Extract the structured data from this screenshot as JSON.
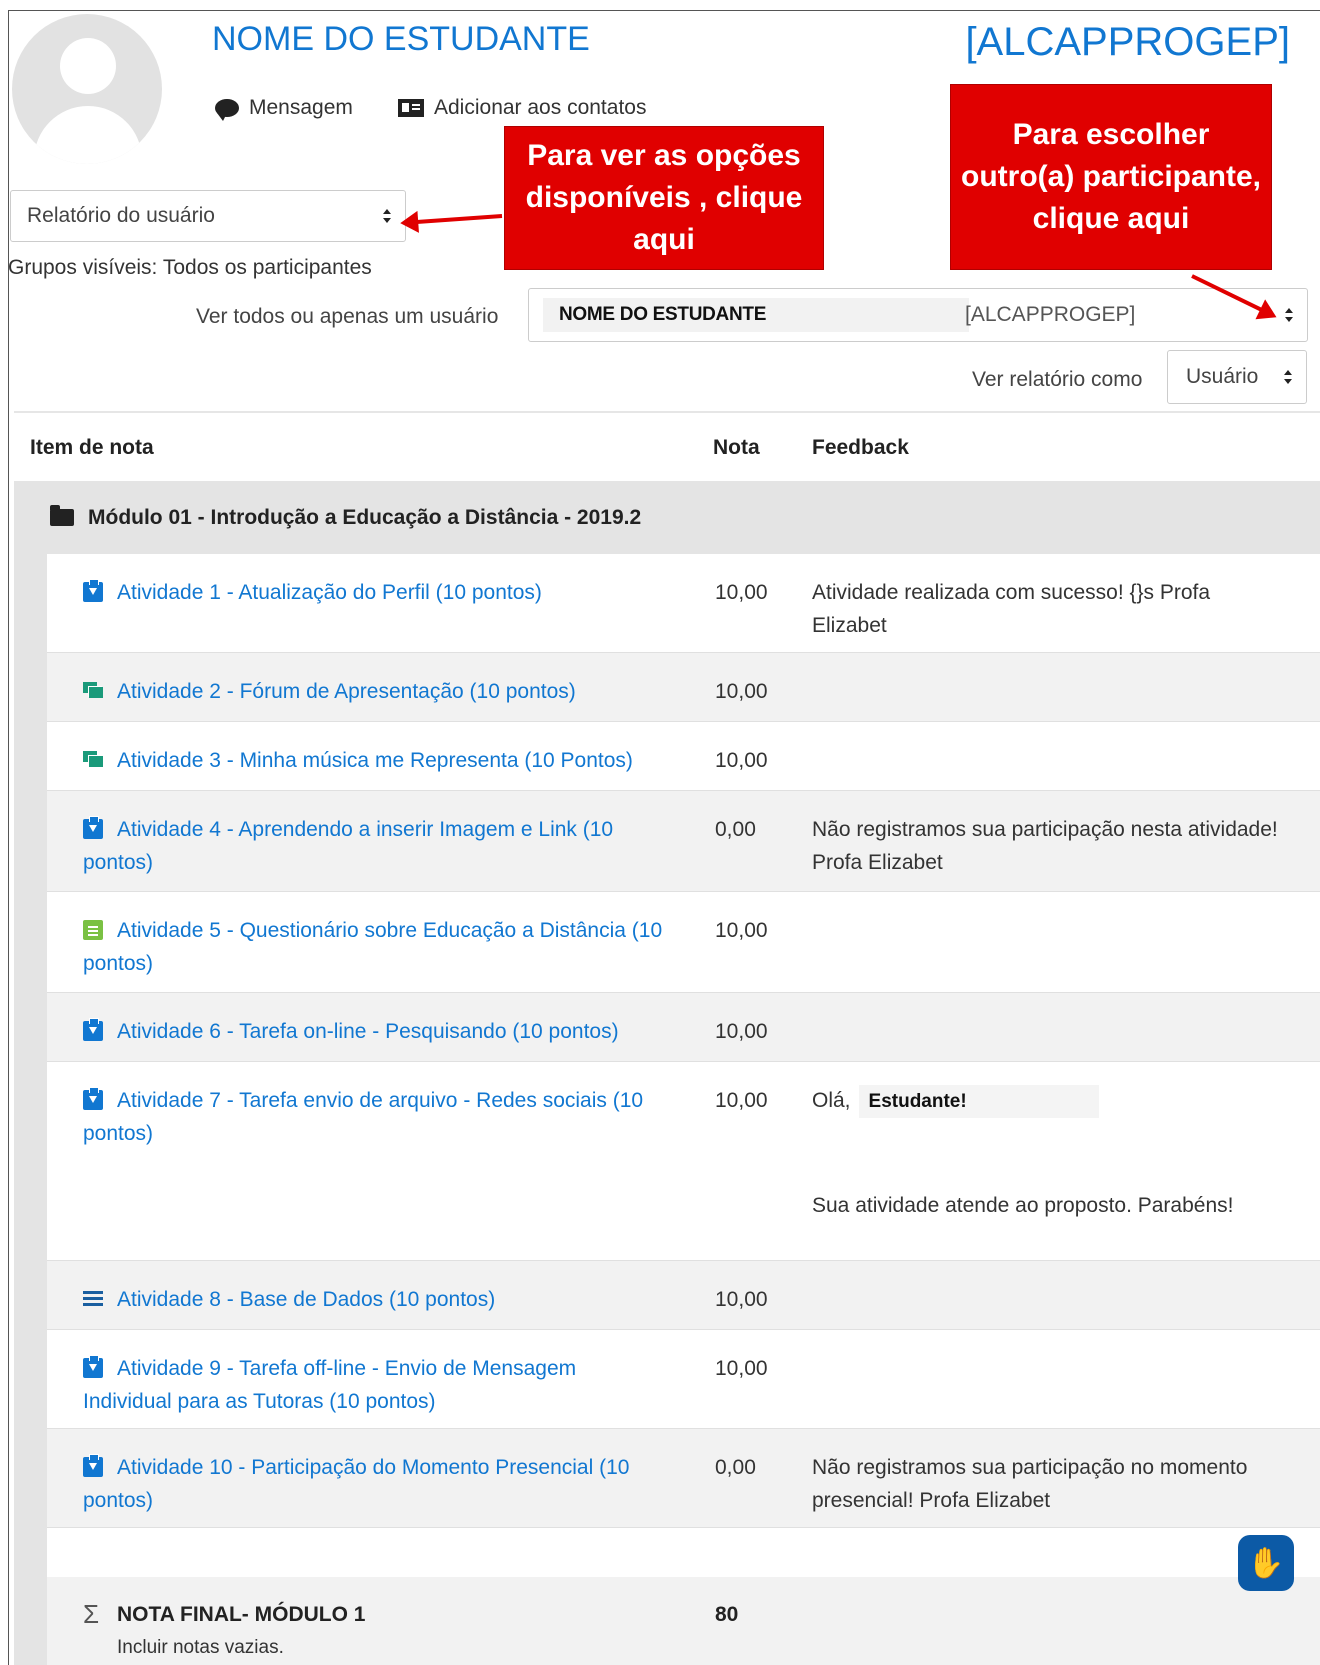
{
  "header": {
    "student_name": "NOME DO ESTUDANTE",
    "course_code": "[ALCAPPROGEP]",
    "actions": {
      "message": "Mensagem",
      "add_contact": "Adicionar aos contatos"
    }
  },
  "controls": {
    "report_select": "Relatório do usuário",
    "visible_groups": "Grupos visíveis: Todos os participantes",
    "user_filter_label": "Ver todos ou apenas um usuário",
    "user_select_name": "NOME DO ESTUDANTE",
    "user_select_code": "[ALCAPPROGEP]",
    "view_as_label": "Ver relatório como",
    "view_as_select": "Usuário"
  },
  "callouts": {
    "options": "Para ver as opções disponíveis , clique aqui",
    "participant": "Para escolher outro(a) participante, clique aqui"
  },
  "table": {
    "headers": {
      "item": "Item de nota",
      "grade": "Nota",
      "feedback": "Feedback"
    },
    "module": "Módulo 01 - Introdução a Educação a Distância - 2019.2",
    "rows": [
      {
        "icon": "assignment-icon",
        "item": "Atividade 1 - Atualização do Perfil (10 pontos)",
        "grade": "10,00",
        "feedback": "Atividade realizada com sucesso! {}s Profa Elizabet"
      },
      {
        "icon": "forum-icon",
        "item": "Atividade 2 - Fórum de Apresentação (10 pontos)",
        "grade": "10,00",
        "feedback": ""
      },
      {
        "icon": "forum-icon",
        "item": "Atividade 3 - Minha música me Representa (10 Pontos)",
        "grade": "10,00",
        "feedback": ""
      },
      {
        "icon": "assignment-icon",
        "item": "Atividade 4 - Aprendendo a inserir Imagem e Link (10 pontos)",
        "grade": "0,00",
        "feedback": "Não registramos sua participação nesta atividade! Profa Elizabet"
      },
      {
        "icon": "quiz-icon",
        "item": "Atividade 5 - Questionário sobre Educação a Distância (10 pontos)",
        "grade": "10,00",
        "feedback": ""
      },
      {
        "icon": "assignment-icon",
        "item": "Atividade 6 - Tarefa on-line - Pesquisando (10 pontos)",
        "grade": "10,00",
        "feedback": ""
      },
      {
        "icon": "assignment-icon",
        "item": "Atividade 7 - Tarefa envio de arquivo - Redes sociais (10 pontos)",
        "grade": "10,00",
        "feedback_greeting": "Olá,",
        "feedback_name": "Estudante!",
        "feedback_second": "Sua atividade atende ao proposto. Parabéns!"
      },
      {
        "icon": "database-icon",
        "item": "Atividade 8 - Base de Dados (10 pontos)",
        "grade": "10,00",
        "feedback": ""
      },
      {
        "icon": "assignment-icon",
        "item": "Atividade 9 - Tarefa off-line - Envio de Mensagem Individual para as Tutoras (10 pontos)",
        "grade": "10,00",
        "feedback": ""
      },
      {
        "icon": "assignment-icon",
        "item": "Atividade 10 - Participação do Momento Presencial (10 pontos)",
        "grade": "0,00",
        "feedback": "Não registramos sua participação no momento presencial! Profa Elizabet"
      }
    ],
    "total": {
      "label": "NOTA FINAL- MÓDULO 1",
      "sub": "Incluir notas vazias.",
      "grade": "80"
    }
  }
}
